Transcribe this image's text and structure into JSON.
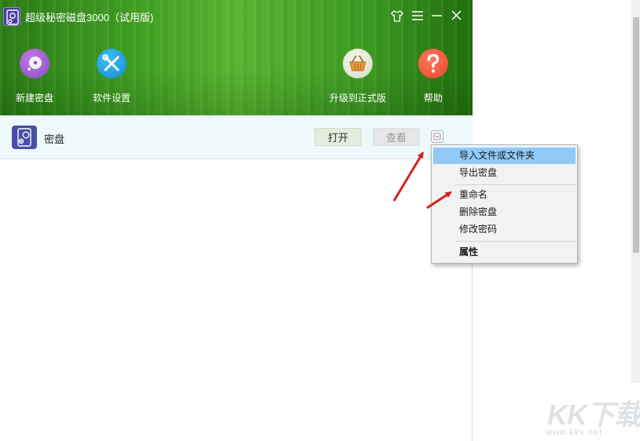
{
  "window": {
    "title": "超级秘密磁盘3000（试用版)"
  },
  "toolbar": {
    "new_disk_label": "新建密盘",
    "settings_label": "软件设置",
    "upgrade_label": "升级到正式版",
    "help_label": "帮助"
  },
  "disk": {
    "name": "密盘",
    "open_label": "打开",
    "view_label": "查看"
  },
  "menu": {
    "items": [
      {
        "label": "导入文件或文件夹",
        "selected": true
      },
      {
        "label": "导出密盘"
      },
      {
        "label": "重命名"
      },
      {
        "label": "删除密盘"
      },
      {
        "label": "修改密码"
      },
      {
        "label": "属性",
        "bold": true
      }
    ]
  },
  "watermark": {
    "brand": "KK下载",
    "url": "www.kkx.net"
  },
  "colors": {
    "header_green": "#3f9c22",
    "menu_highlight": "#91c9f7",
    "arrow_red": "#d8201e",
    "disk_icon": "#4a4fa8"
  }
}
